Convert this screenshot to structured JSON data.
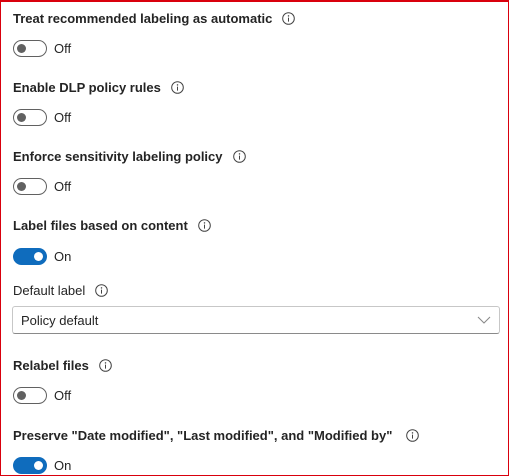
{
  "settings": {
    "treat_recommended": {
      "title": "Treat recommended labeling as automatic",
      "state": "Off",
      "enabled": false
    },
    "enable_dlp": {
      "title": "Enable DLP policy rules",
      "state": "Off",
      "enabled": false
    },
    "enforce_sensitivity": {
      "title": "Enforce sensitivity labeling policy",
      "state": "Off",
      "enabled": false
    },
    "label_files": {
      "title": "Label files based on content",
      "state": "On",
      "enabled": true
    },
    "default_label": {
      "title": "Default label",
      "value": "Policy default"
    },
    "relabel_files": {
      "title": "Relabel files",
      "state": "Off",
      "enabled": false
    },
    "preserve": {
      "title": "Preserve \"Date modified\", \"Last modified\", and \"Modified by\"",
      "state": "On",
      "enabled": true
    }
  },
  "icons": {
    "info": "info-icon",
    "dropdown": "chevron-down-icon"
  },
  "colors": {
    "accent": "#0f6cbd",
    "toggle_off": "#616161",
    "border_highlight": "#d9000d"
  }
}
